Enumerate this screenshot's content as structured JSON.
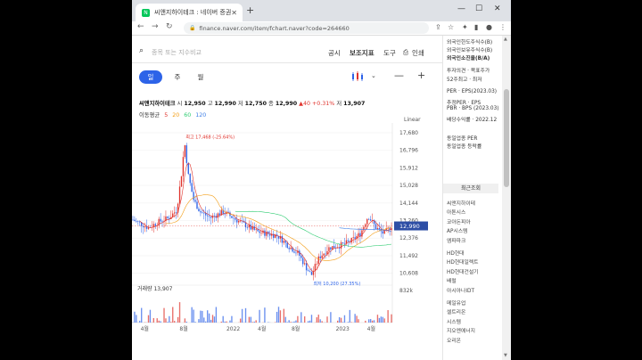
{
  "browser": {
    "tab_title": "씨앤지하이테크 : 네이버 증권",
    "url": "finance.naver.com/item/fchart.naver?code=264660"
  },
  "toolbar": {
    "search_placeholder": "종목 또는 지수비교",
    "links": [
      "공시",
      "보조지표",
      "도구",
      "인쇄"
    ]
  },
  "periods": [
    "일",
    "주",
    "월"
  ],
  "info": {
    "name": "씨앤지하이테크",
    "open_label": "시",
    "open": "12,950",
    "high_label": "고",
    "high": "12,990",
    "low_label": "저",
    "low": "12,750",
    "close_label": "종",
    "close": "12,990",
    "change": "▲40",
    "change_pct": "+0.31%",
    "prev_label": "저",
    "prev": "13,907"
  },
  "ma": {
    "label": "이동평균",
    "periods": [
      "5",
      "20",
      "60",
      "120"
    ],
    "colors": [
      "#e0332c",
      "#f39c12",
      "#2ecc71",
      "#3d7ee6"
    ]
  },
  "scale_label": "Linear",
  "chart_data": {
    "type": "candlestick",
    "y_ticks": [
      17680,
      16796,
      15912,
      15028,
      14144,
      13260,
      12376,
      11492,
      10608
    ],
    "y_tick_labels": [
      "17,680",
      "16,796",
      "15,912",
      "15,028",
      "14,144",
      "13,260",
      "12,376",
      "11,492",
      "10,608"
    ],
    "ylim": [
      10100,
      17900
    ],
    "x_tick_labels": [
      "4월",
      "8월",
      "2022",
      "4월",
      "8월",
      "2023",
      "4월"
    ],
    "x_tick_fractions": [
      0.05,
      0.2,
      0.38,
      0.5,
      0.63,
      0.8,
      0.92
    ],
    "current_price": 12990,
    "current_price_label": "12,990",
    "max_annotation": "최고 17,468 (-25.64%)",
    "max_value": 17468,
    "max_fraction": 0.2,
    "min_annotation": "최저 10,200 (27.35%)",
    "min_value": 10200,
    "min_fraction": 0.69,
    "volume_label": "거래량 13,907",
    "volume_axis_label": "832k",
    "anchors": [
      [
        0.0,
        13300
      ],
      [
        0.03,
        13100
      ],
      [
        0.06,
        12900
      ],
      [
        0.1,
        13200
      ],
      [
        0.14,
        13400
      ],
      [
        0.17,
        13800
      ],
      [
        0.19,
        15800
      ],
      [
        0.2,
        17200
      ],
      [
        0.215,
        15500
      ],
      [
        0.235,
        14300
      ],
      [
        0.26,
        13700
      ],
      [
        0.3,
        13400
      ],
      [
        0.35,
        13700
      ],
      [
        0.4,
        13300
      ],
      [
        0.44,
        13000
      ],
      [
        0.48,
        12700
      ],
      [
        0.52,
        12600
      ],
      [
        0.56,
        12500
      ],
      [
        0.6,
        12000
      ],
      [
        0.64,
        11600
      ],
      [
        0.67,
        10900
      ],
      [
        0.69,
        10500
      ],
      [
        0.72,
        11400
      ],
      [
        0.76,
        11900
      ],
      [
        0.8,
        12000
      ],
      [
        0.84,
        12200
      ],
      [
        0.88,
        12600
      ],
      [
        0.91,
        13500
      ],
      [
        0.94,
        12900
      ],
      [
        0.97,
        12600
      ],
      [
        1.0,
        12990
      ]
    ]
  },
  "right_panel": {
    "top_items": [
      "외국인한도주식수(B)",
      "외국인보유주식수(B)",
      "외국인소진율(B/A)"
    ],
    "mid_items": [
      "투자의견 · 목표주가",
      "52주최고 · 최저"
    ],
    "per_items": [
      "PER · EPS(2023.03)",
      "추정PER · EPS",
      "PBR · BPS (2023.03)",
      "배당수익률 · 2022.12"
    ],
    "sector_items": [
      "동일업종 PER",
      "동일업종 등락률"
    ],
    "recent_header": "최근조회",
    "recent_items": [
      "씨앤지하이테",
      "아톤시스",
      "코아돈피아",
      "AP시스템",
      "엠파파크",
      "HD현대",
      "HD현대일렉트",
      "HD현대건설기",
      "배럴",
      "아시아나IDT",
      "메일유업",
      "셀트리온",
      "시스템",
      "지오엔에너지",
      "오리온"
    ]
  }
}
